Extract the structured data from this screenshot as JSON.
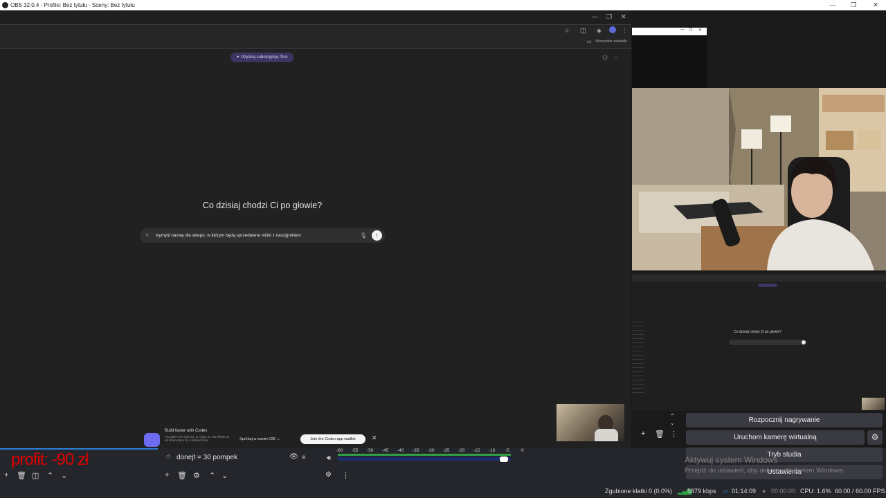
{
  "window": {
    "title": "OBS 32.0.4 - Profile: Bez tytułu - Sceny: Bez tytułu",
    "minimize": "—",
    "restore": "❐",
    "close": "✕"
  },
  "browser": {
    "bookmark_folder": "Wszystkie zakładki",
    "upgrade_pill": "✦ Uzyskaj subskrypcję Plus",
    "headline": "Co dzisiaj chodzi Ci po głowie?",
    "prompt_value": "wymyśl nazwę dla sklepu, w którym będą sprzedawne miśki z naszyjnikiem",
    "codex_banner": {
      "title": "Build faster with Codex",
      "subtitle": "Try with Free and Go, or enjoy 2x rate limits on all other plans for a limited time.",
      "ide_button": "Spróbuj w swoim IDE",
      "join_button": "Join the Codex app waitlist"
    }
  },
  "mini_preview": {
    "headline": "Co dzisiaj chodzi Ci po głowie?"
  },
  "overlay": {
    "profit_text": "profit: -90 zł"
  },
  "sources": {
    "item_label": "donejt = 30 pompek"
  },
  "mixer": {
    "scale": [
      "-60",
      "-55",
      "-50",
      "-45",
      "-40",
      "-35",
      "-30",
      "-25",
      "-20",
      "-15",
      "-10",
      "-5",
      "0"
    ],
    "volume_level": 0.96
  },
  "controls": {
    "record": "Rozpocznij nagrywanie",
    "virtual_camera": "Uruchom kamerę wirtualną",
    "studio_mode": "Tryb studia",
    "settings": "Ustawienia"
  },
  "windows_watermark": {
    "line1": "Aktywuj system Windows",
    "line2": "Przejdź do ustawień, aby aktywować system Windows."
  },
  "status": {
    "dropped_frames": "Zgubione klatki 0 (0.0%)",
    "bitrate": "5879 kbps",
    "stream_time": "01:14:09",
    "record_time": "00:00:00",
    "cpu": "CPU: 1.6%",
    "fps": "60.00 / 60.00 FPS"
  },
  "colors": {
    "accent": "#2c7dd6",
    "profit": "#e00000",
    "meter_green": "#2fa043"
  }
}
